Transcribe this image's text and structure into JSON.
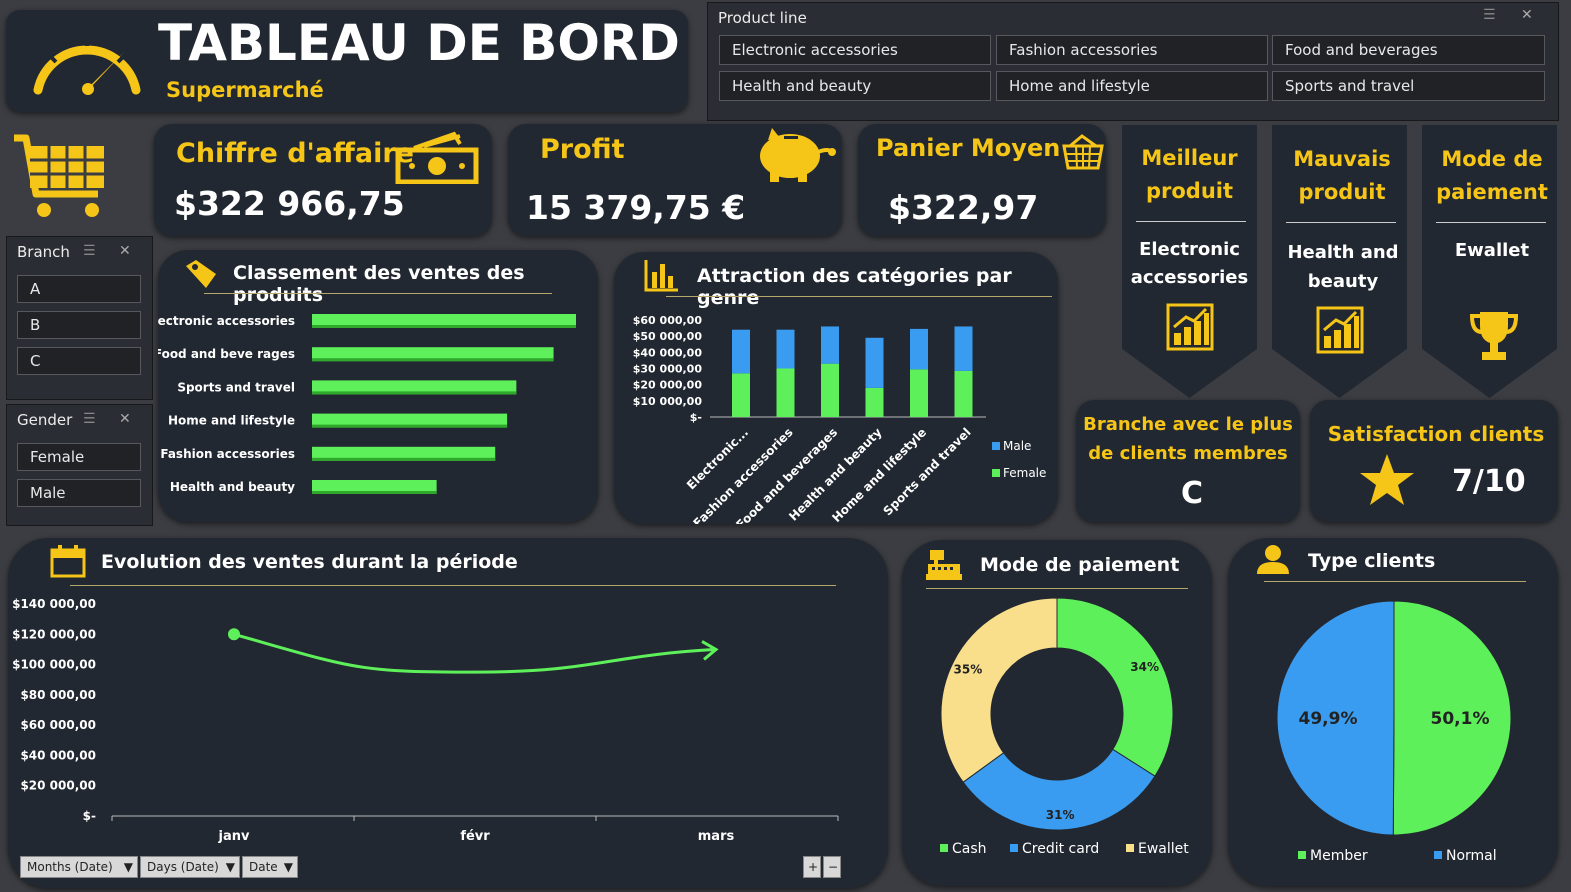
{
  "header": {
    "title": "TABLEAU DE BORD",
    "subtitle": "Supermarché"
  },
  "product_line_slicer": {
    "title": "Product line",
    "items": [
      "Electronic accessories",
      "Fashion accessories",
      "Food and beverages",
      "Health and beauty",
      "Home and lifestyle",
      "Sports and travel"
    ]
  },
  "branch_slicer": {
    "title": "Branch",
    "items": [
      "A",
      "B",
      "C"
    ]
  },
  "gender_slicer": {
    "title": "Gender",
    "items": [
      "Female",
      "Male"
    ]
  },
  "kpis": {
    "ca": {
      "label": "Chiffre d'affaire",
      "value": "$322 966,75"
    },
    "profit": {
      "label": "Profit",
      "value": "15 379,75 €"
    },
    "panier": {
      "label": "Panier Moyen",
      "value": "$322,97"
    }
  },
  "badges": {
    "best": {
      "title1": "Meilleur",
      "title2": "produit",
      "value1": "Electronic",
      "value2": "accessories"
    },
    "worst": {
      "title1": "Mauvais",
      "title2": "produit",
      "value1": "Health and",
      "value2": "beauty"
    },
    "payment": {
      "title1": "Mode de",
      "title2": "paiement",
      "value1": "Ewallet"
    }
  },
  "branch_card": {
    "title1": "Branche avec le plus",
    "title2": "de clients membres",
    "value": "C"
  },
  "satisfaction_card": {
    "title": "Satisfaction clients",
    "value": "7/10"
  },
  "colors": {
    "accent": "#f5c518",
    "panel": "#222831",
    "bg": "#3b3d42",
    "green": "#5ef05a",
    "blue": "#3a9cf0",
    "yellow": "#f9df8c"
  },
  "icons": [
    "speedometer-icon",
    "cart-icon",
    "money-icon",
    "piggy-bank-icon",
    "basket-icon",
    "tag-icon",
    "bar-chart-icon",
    "calendar-icon",
    "cash-register-icon",
    "user-icon",
    "trophy-icon",
    "star-icon"
  ],
  "chart_ranking": {
    "title": "Classement des ventes des produits"
  },
  "chart_gender": {
    "title": "Attraction des catégories par genre"
  },
  "chart_evolution": {
    "title": "Evolution des ventes durant la période"
  },
  "chart_payment": {
    "title": "Mode de paiement"
  },
  "chart_type": {
    "title": "Type clients"
  },
  "pivot_controls": {
    "months": "Months (Date)",
    "days": "Days (Date)",
    "date": "Date",
    "plus": "+",
    "minus": "−"
  },
  "chart_data": [
    {
      "type": "bar",
      "orientation": "horizontal",
      "title": "Classement des ventes des produits",
      "categories": [
        "Electronic accessories",
        "Food and beverages",
        "Sports and travel",
        "Home and lifestyle",
        "Fashion accessories",
        "Health and beauty"
      ],
      "category_labels": [
        "Electronic accessories",
        "Food and beve rages",
        "Sports and travel",
        "Home and lifestyle",
        "Fashion accessories",
        "Health and beauty"
      ],
      "values": [
        100,
        91.5,
        77.4,
        73.9,
        69.4,
        47.2
      ],
      "color": "#5ef05a"
    },
    {
      "type": "bar",
      "stacked": true,
      "title": "Attraction des catégories par genre",
      "categories": [
        "Electronic...",
        "Fashion accessories",
        "Food and beverages",
        "Health and beauty",
        "Home and lifestyle",
        "Sports and travel"
      ],
      "series": [
        {
          "name": "Female",
          "color": "#5ef05a",
          "values": [
            27000,
            30000,
            33000,
            18000,
            29500,
            28500
          ]
        },
        {
          "name": "Male",
          "color": "#3a9cf0",
          "values": [
            27000,
            24000,
            23000,
            31000,
            25000,
            27500
          ]
        }
      ],
      "ylim": [
        0,
        60000
      ],
      "yticks": [
        "$60 000,00",
        "$50 000,00",
        "$40 000,00",
        "$30 000,00",
        "$20 000,00",
        "$10 000,00",
        "$-"
      ]
    },
    {
      "type": "line",
      "title": "Evolution des ventes durant la période",
      "x": [
        "janv",
        "févr",
        "mars"
      ],
      "values": [
        120000,
        95000,
        110000
      ],
      "ylim": [
        0,
        140000
      ],
      "yticks": [
        "$140 000,00",
        "$120 000,00",
        "$100 000,00",
        "$80 000,00",
        "$60 000,00",
        "$40 000,00",
        "$20 000,00",
        "$-"
      ],
      "color": "#5ef05a"
    },
    {
      "type": "pie",
      "donut": true,
      "title": "Mode de paiement",
      "labels": [
        "Cash",
        "Credit card",
        "Ewallet"
      ],
      "values": [
        34,
        31,
        35
      ],
      "value_labels": [
        "34%",
        "31%",
        "35%"
      ],
      "colors": [
        "#5ef05a",
        "#3a9cf0",
        "#f9df8c"
      ]
    },
    {
      "type": "pie",
      "title": "Type clients",
      "labels": [
        "Member",
        "Normal"
      ],
      "values": [
        50.1,
        49.9
      ],
      "value_labels": [
        "50,1%",
        "49,9%"
      ],
      "colors": [
        "#5ef05a",
        "#3a9cf0"
      ]
    }
  ]
}
